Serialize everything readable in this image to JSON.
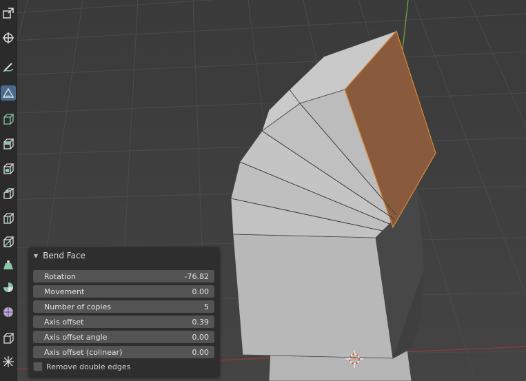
{
  "operator_panel": {
    "title": "Bend Face",
    "fields": [
      {
        "label": "Rotation",
        "value": "-76.82"
      },
      {
        "label": "Movement",
        "value": "0.00"
      },
      {
        "label": "Number of copies",
        "value": "5"
      },
      {
        "label": "Axis offset",
        "value": "0.39"
      },
      {
        "label": "Axis offset angle",
        "value": "0.00"
      },
      {
        "label": "Axis offset (colinear)",
        "value": "0.00"
      }
    ],
    "checkbox": {
      "label": "Remove double edges",
      "checked": false
    }
  },
  "toolbar": {
    "tools": [
      "scale-icon",
      "transform-icon",
      "annotate-icon",
      "measure-icon",
      "add-cube-icon",
      "extrude-icon",
      "inset-icon",
      "bevel-icon",
      "loop-cut-icon",
      "knife-icon",
      "poly-build-icon",
      "spin-icon",
      "smooth-icon",
      "edge-slide-icon",
      "shrink-fatten-icon"
    ],
    "active_tool": "measure-icon"
  },
  "colors": {
    "viewport_bg": "#3d3d3d",
    "grid": "#4a4a4a",
    "selected_face": "#8a5a3c",
    "mesh": "#b8b8b8",
    "x_axis": "#9a3a3a",
    "y_axis": "#7ca83a"
  }
}
